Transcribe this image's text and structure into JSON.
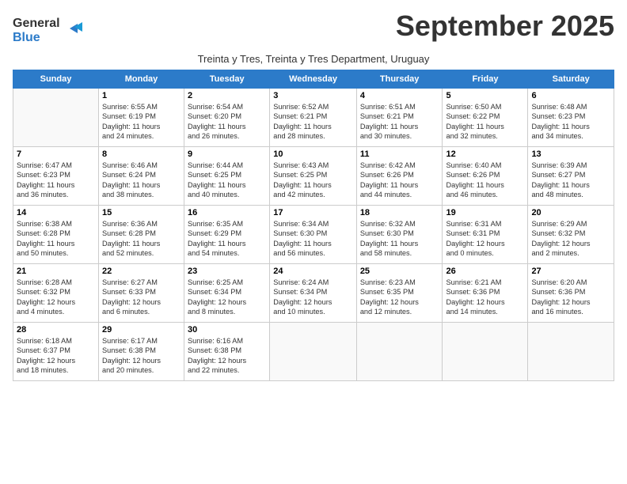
{
  "header": {
    "logo_line1": "General",
    "logo_line2": "Blue",
    "month_title": "September 2025",
    "subtitle": "Treinta y Tres, Treinta y Tres Department, Uruguay"
  },
  "days_of_week": [
    "Sunday",
    "Monday",
    "Tuesday",
    "Wednesday",
    "Thursday",
    "Friday",
    "Saturday"
  ],
  "weeks": [
    [
      {
        "day": "",
        "info": ""
      },
      {
        "day": "1",
        "info": "Sunrise: 6:55 AM\nSunset: 6:19 PM\nDaylight: 11 hours\nand 24 minutes."
      },
      {
        "day": "2",
        "info": "Sunrise: 6:54 AM\nSunset: 6:20 PM\nDaylight: 11 hours\nand 26 minutes."
      },
      {
        "day": "3",
        "info": "Sunrise: 6:52 AM\nSunset: 6:21 PM\nDaylight: 11 hours\nand 28 minutes."
      },
      {
        "day": "4",
        "info": "Sunrise: 6:51 AM\nSunset: 6:21 PM\nDaylight: 11 hours\nand 30 minutes."
      },
      {
        "day": "5",
        "info": "Sunrise: 6:50 AM\nSunset: 6:22 PM\nDaylight: 11 hours\nand 32 minutes."
      },
      {
        "day": "6",
        "info": "Sunrise: 6:48 AM\nSunset: 6:23 PM\nDaylight: 11 hours\nand 34 minutes."
      }
    ],
    [
      {
        "day": "7",
        "info": "Sunrise: 6:47 AM\nSunset: 6:23 PM\nDaylight: 11 hours\nand 36 minutes."
      },
      {
        "day": "8",
        "info": "Sunrise: 6:46 AM\nSunset: 6:24 PM\nDaylight: 11 hours\nand 38 minutes."
      },
      {
        "day": "9",
        "info": "Sunrise: 6:44 AM\nSunset: 6:25 PM\nDaylight: 11 hours\nand 40 minutes."
      },
      {
        "day": "10",
        "info": "Sunrise: 6:43 AM\nSunset: 6:25 PM\nDaylight: 11 hours\nand 42 minutes."
      },
      {
        "day": "11",
        "info": "Sunrise: 6:42 AM\nSunset: 6:26 PM\nDaylight: 11 hours\nand 44 minutes."
      },
      {
        "day": "12",
        "info": "Sunrise: 6:40 AM\nSunset: 6:26 PM\nDaylight: 11 hours\nand 46 minutes."
      },
      {
        "day": "13",
        "info": "Sunrise: 6:39 AM\nSunset: 6:27 PM\nDaylight: 11 hours\nand 48 minutes."
      }
    ],
    [
      {
        "day": "14",
        "info": "Sunrise: 6:38 AM\nSunset: 6:28 PM\nDaylight: 11 hours\nand 50 minutes."
      },
      {
        "day": "15",
        "info": "Sunrise: 6:36 AM\nSunset: 6:28 PM\nDaylight: 11 hours\nand 52 minutes."
      },
      {
        "day": "16",
        "info": "Sunrise: 6:35 AM\nSunset: 6:29 PM\nDaylight: 11 hours\nand 54 minutes."
      },
      {
        "day": "17",
        "info": "Sunrise: 6:34 AM\nSunset: 6:30 PM\nDaylight: 11 hours\nand 56 minutes."
      },
      {
        "day": "18",
        "info": "Sunrise: 6:32 AM\nSunset: 6:30 PM\nDaylight: 11 hours\nand 58 minutes."
      },
      {
        "day": "19",
        "info": "Sunrise: 6:31 AM\nSunset: 6:31 PM\nDaylight: 12 hours\nand 0 minutes."
      },
      {
        "day": "20",
        "info": "Sunrise: 6:29 AM\nSunset: 6:32 PM\nDaylight: 12 hours\nand 2 minutes."
      }
    ],
    [
      {
        "day": "21",
        "info": "Sunrise: 6:28 AM\nSunset: 6:32 PM\nDaylight: 12 hours\nand 4 minutes."
      },
      {
        "day": "22",
        "info": "Sunrise: 6:27 AM\nSunset: 6:33 PM\nDaylight: 12 hours\nand 6 minutes."
      },
      {
        "day": "23",
        "info": "Sunrise: 6:25 AM\nSunset: 6:34 PM\nDaylight: 12 hours\nand 8 minutes."
      },
      {
        "day": "24",
        "info": "Sunrise: 6:24 AM\nSunset: 6:34 PM\nDaylight: 12 hours\nand 10 minutes."
      },
      {
        "day": "25",
        "info": "Sunrise: 6:23 AM\nSunset: 6:35 PM\nDaylight: 12 hours\nand 12 minutes."
      },
      {
        "day": "26",
        "info": "Sunrise: 6:21 AM\nSunset: 6:36 PM\nDaylight: 12 hours\nand 14 minutes."
      },
      {
        "day": "27",
        "info": "Sunrise: 6:20 AM\nSunset: 6:36 PM\nDaylight: 12 hours\nand 16 minutes."
      }
    ],
    [
      {
        "day": "28",
        "info": "Sunrise: 6:18 AM\nSunset: 6:37 PM\nDaylight: 12 hours\nand 18 minutes."
      },
      {
        "day": "29",
        "info": "Sunrise: 6:17 AM\nSunset: 6:38 PM\nDaylight: 12 hours\nand 20 minutes."
      },
      {
        "day": "30",
        "info": "Sunrise: 6:16 AM\nSunset: 6:38 PM\nDaylight: 12 hours\nand 22 minutes."
      },
      {
        "day": "",
        "info": ""
      },
      {
        "day": "",
        "info": ""
      },
      {
        "day": "",
        "info": ""
      },
      {
        "day": "",
        "info": ""
      }
    ]
  ]
}
